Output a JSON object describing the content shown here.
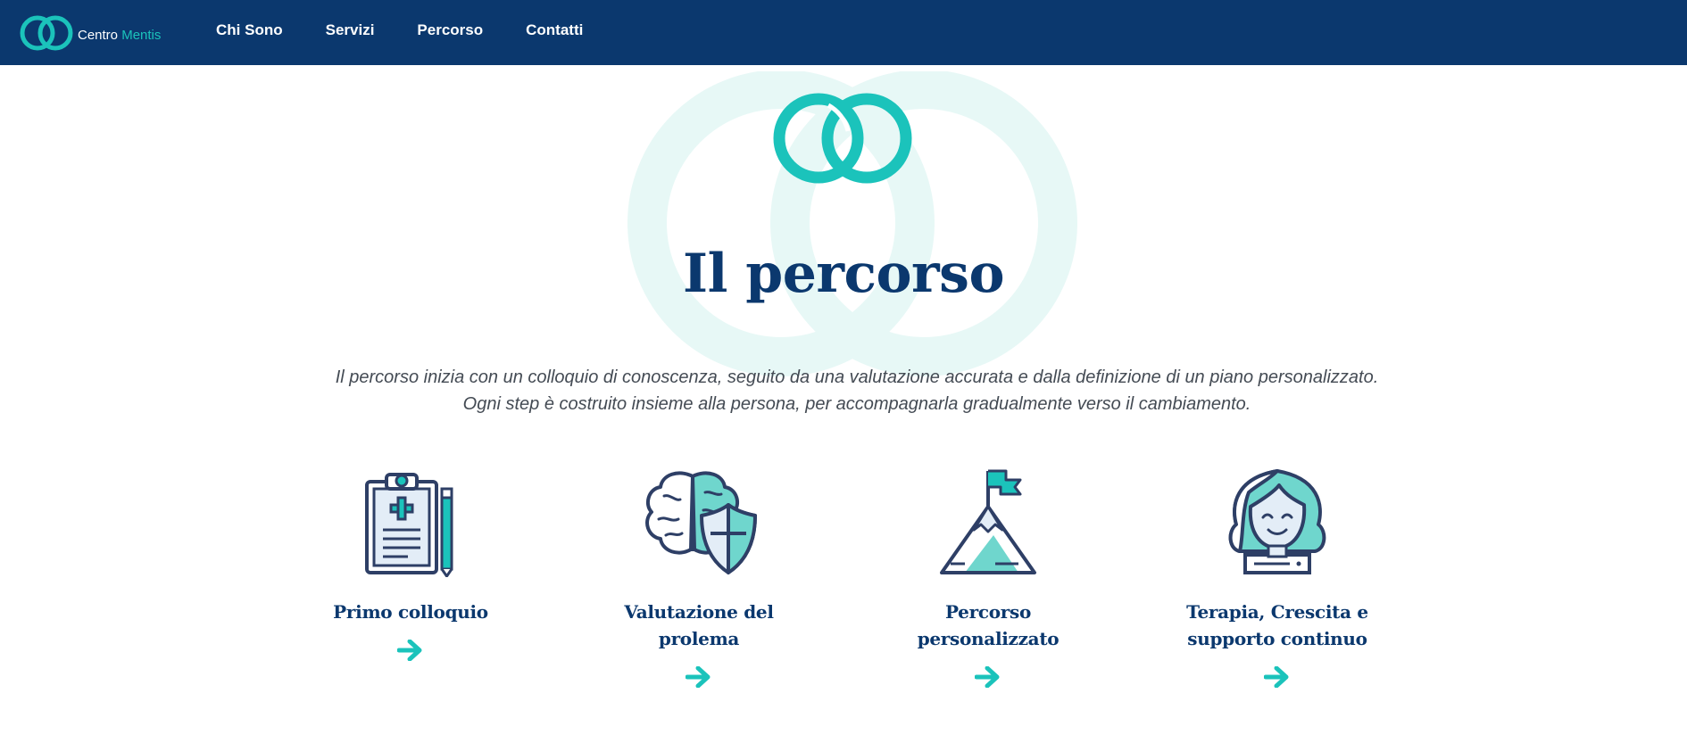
{
  "brand": {
    "name_part1": "Centro",
    "name_part2": "Mentis"
  },
  "nav": [
    {
      "label": "Chi Sono"
    },
    {
      "label": "Servizi"
    },
    {
      "label": "Percorso"
    },
    {
      "label": "Contatti"
    }
  ],
  "main": {
    "title": "Il percorso",
    "intro_line1": "Il percorso inizia con un colloquio di conoscenza, seguito da una valutazione accurata e dalla definizione di un piano personalizzato.",
    "intro_line2": "Ogni step è costruito insieme alla persona, per accompagnarla gradualmente verso il cambiamento."
  },
  "steps": [
    {
      "title": "Primo colloquio",
      "icon": "clipboard-icon"
    },
    {
      "title": "Valutazione del prolema",
      "icon": "brain-shield-icon"
    },
    {
      "title": "Percorso personalizzato",
      "icon": "mountain-flag-icon"
    },
    {
      "title_line1": "Terapia, Crescita e",
      "title_line2": "supporto continuo",
      "icon": "woman-icon"
    }
  ],
  "colors": {
    "navy": "#0b386e",
    "teal": "#1bc3bb",
    "teal_light": "#e7f8f6",
    "icon_stroke": "#2e3f66"
  }
}
